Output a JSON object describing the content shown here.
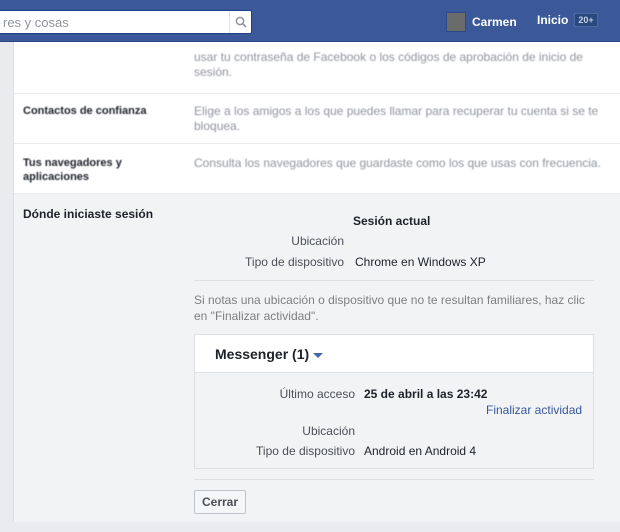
{
  "header": {
    "search_value": "res y cosas",
    "user_name": "Carmen",
    "home_label": "Inicio",
    "badge": "20+"
  },
  "settings": {
    "rows": [
      {
        "label": "",
        "description": "usar tu contraseña de Facebook o los códigos de aprobación de inicio de sesión."
      },
      {
        "label": "Contactos de confianza",
        "description": "Elige a los amigos a los que puedes llamar para recuperar tu cuenta si se te bloquea."
      },
      {
        "label": "Tus navegadores y aplicaciones",
        "description": "Consulta los navegadores que guardaste como los que usas con frecuencia."
      }
    ],
    "sessions": {
      "label": "Dónde iniciaste sesión",
      "current": {
        "heading": "Sesión actual",
        "location_label": "Ubicación",
        "location_value": "",
        "device_label": "Tipo de dispositivo",
        "device_value": "Chrome en Windows XP"
      },
      "hint": "Si notas una ubicación o dispositivo que no te resultan familiares, haz clic en \"Finalizar actividad\".",
      "messenger": {
        "title": "Messenger (1)",
        "last_access_label": "Último acceso",
        "last_access_value": "25 de abril a las 23:42",
        "end_activity": "Finalizar actividad",
        "location_label": "Ubicación",
        "location_value": "",
        "device_label": "Tipo de dispositivo",
        "device_value": "Android en Android 4"
      },
      "close_button": "Cerrar"
    }
  },
  "colors": {
    "topbar": "#3b5998",
    "link": "#365899"
  },
  "icons": {
    "search": "search-icon",
    "dropdown": "chevron-down-icon"
  }
}
